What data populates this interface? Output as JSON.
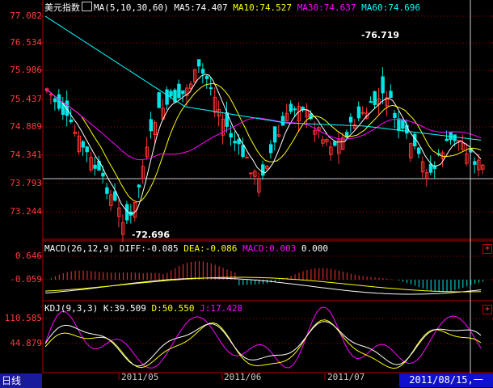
{
  "panels": {
    "price": {
      "title": "美元指数",
      "indicator": "MA(5,10,30,60)",
      "ma5": "MA5:74.407",
      "ma10": "MA10:74.527",
      "ma30": "MA30:74.637",
      "ma60": "MA60:74.696",
      "axis": [
        "77.082",
        "76.534",
        "75.986",
        "75.437",
        "74.889",
        "74.341",
        "73.793",
        "73.244"
      ],
      "high_label": "76.719",
      "low_label": "72.696"
    },
    "macd": {
      "title": "MACD(26,12,9)",
      "diff": "DIFF:-0.085",
      "dea": "DEA:-0.086",
      "macd": "MACD:0.003",
      "extra": "0.000",
      "axis": [
        "0.646",
        "-0.059"
      ]
    },
    "kdj": {
      "title": "KDJ(9,3,3)",
      "k": "K:39.509",
      "d": "D:50.550",
      "j": "J:17.428",
      "axis": [
        "110.585",
        "44.879"
      ]
    }
  },
  "footer": {
    "period_tab": "日线",
    "dates": [
      "2011/05",
      "2011/06",
      "2011/07"
    ],
    "cursor_date": "2011/08/15,一"
  },
  "buttons": {
    "expand": "+"
  },
  "colors": {
    "up": "#ff3232",
    "down": "#00e6e6",
    "ma5": "#ffffff",
    "ma10": "#ffff00",
    "ma30": "#ff00ff",
    "ma60": "#00ffff",
    "axis": "#b00000"
  }
}
